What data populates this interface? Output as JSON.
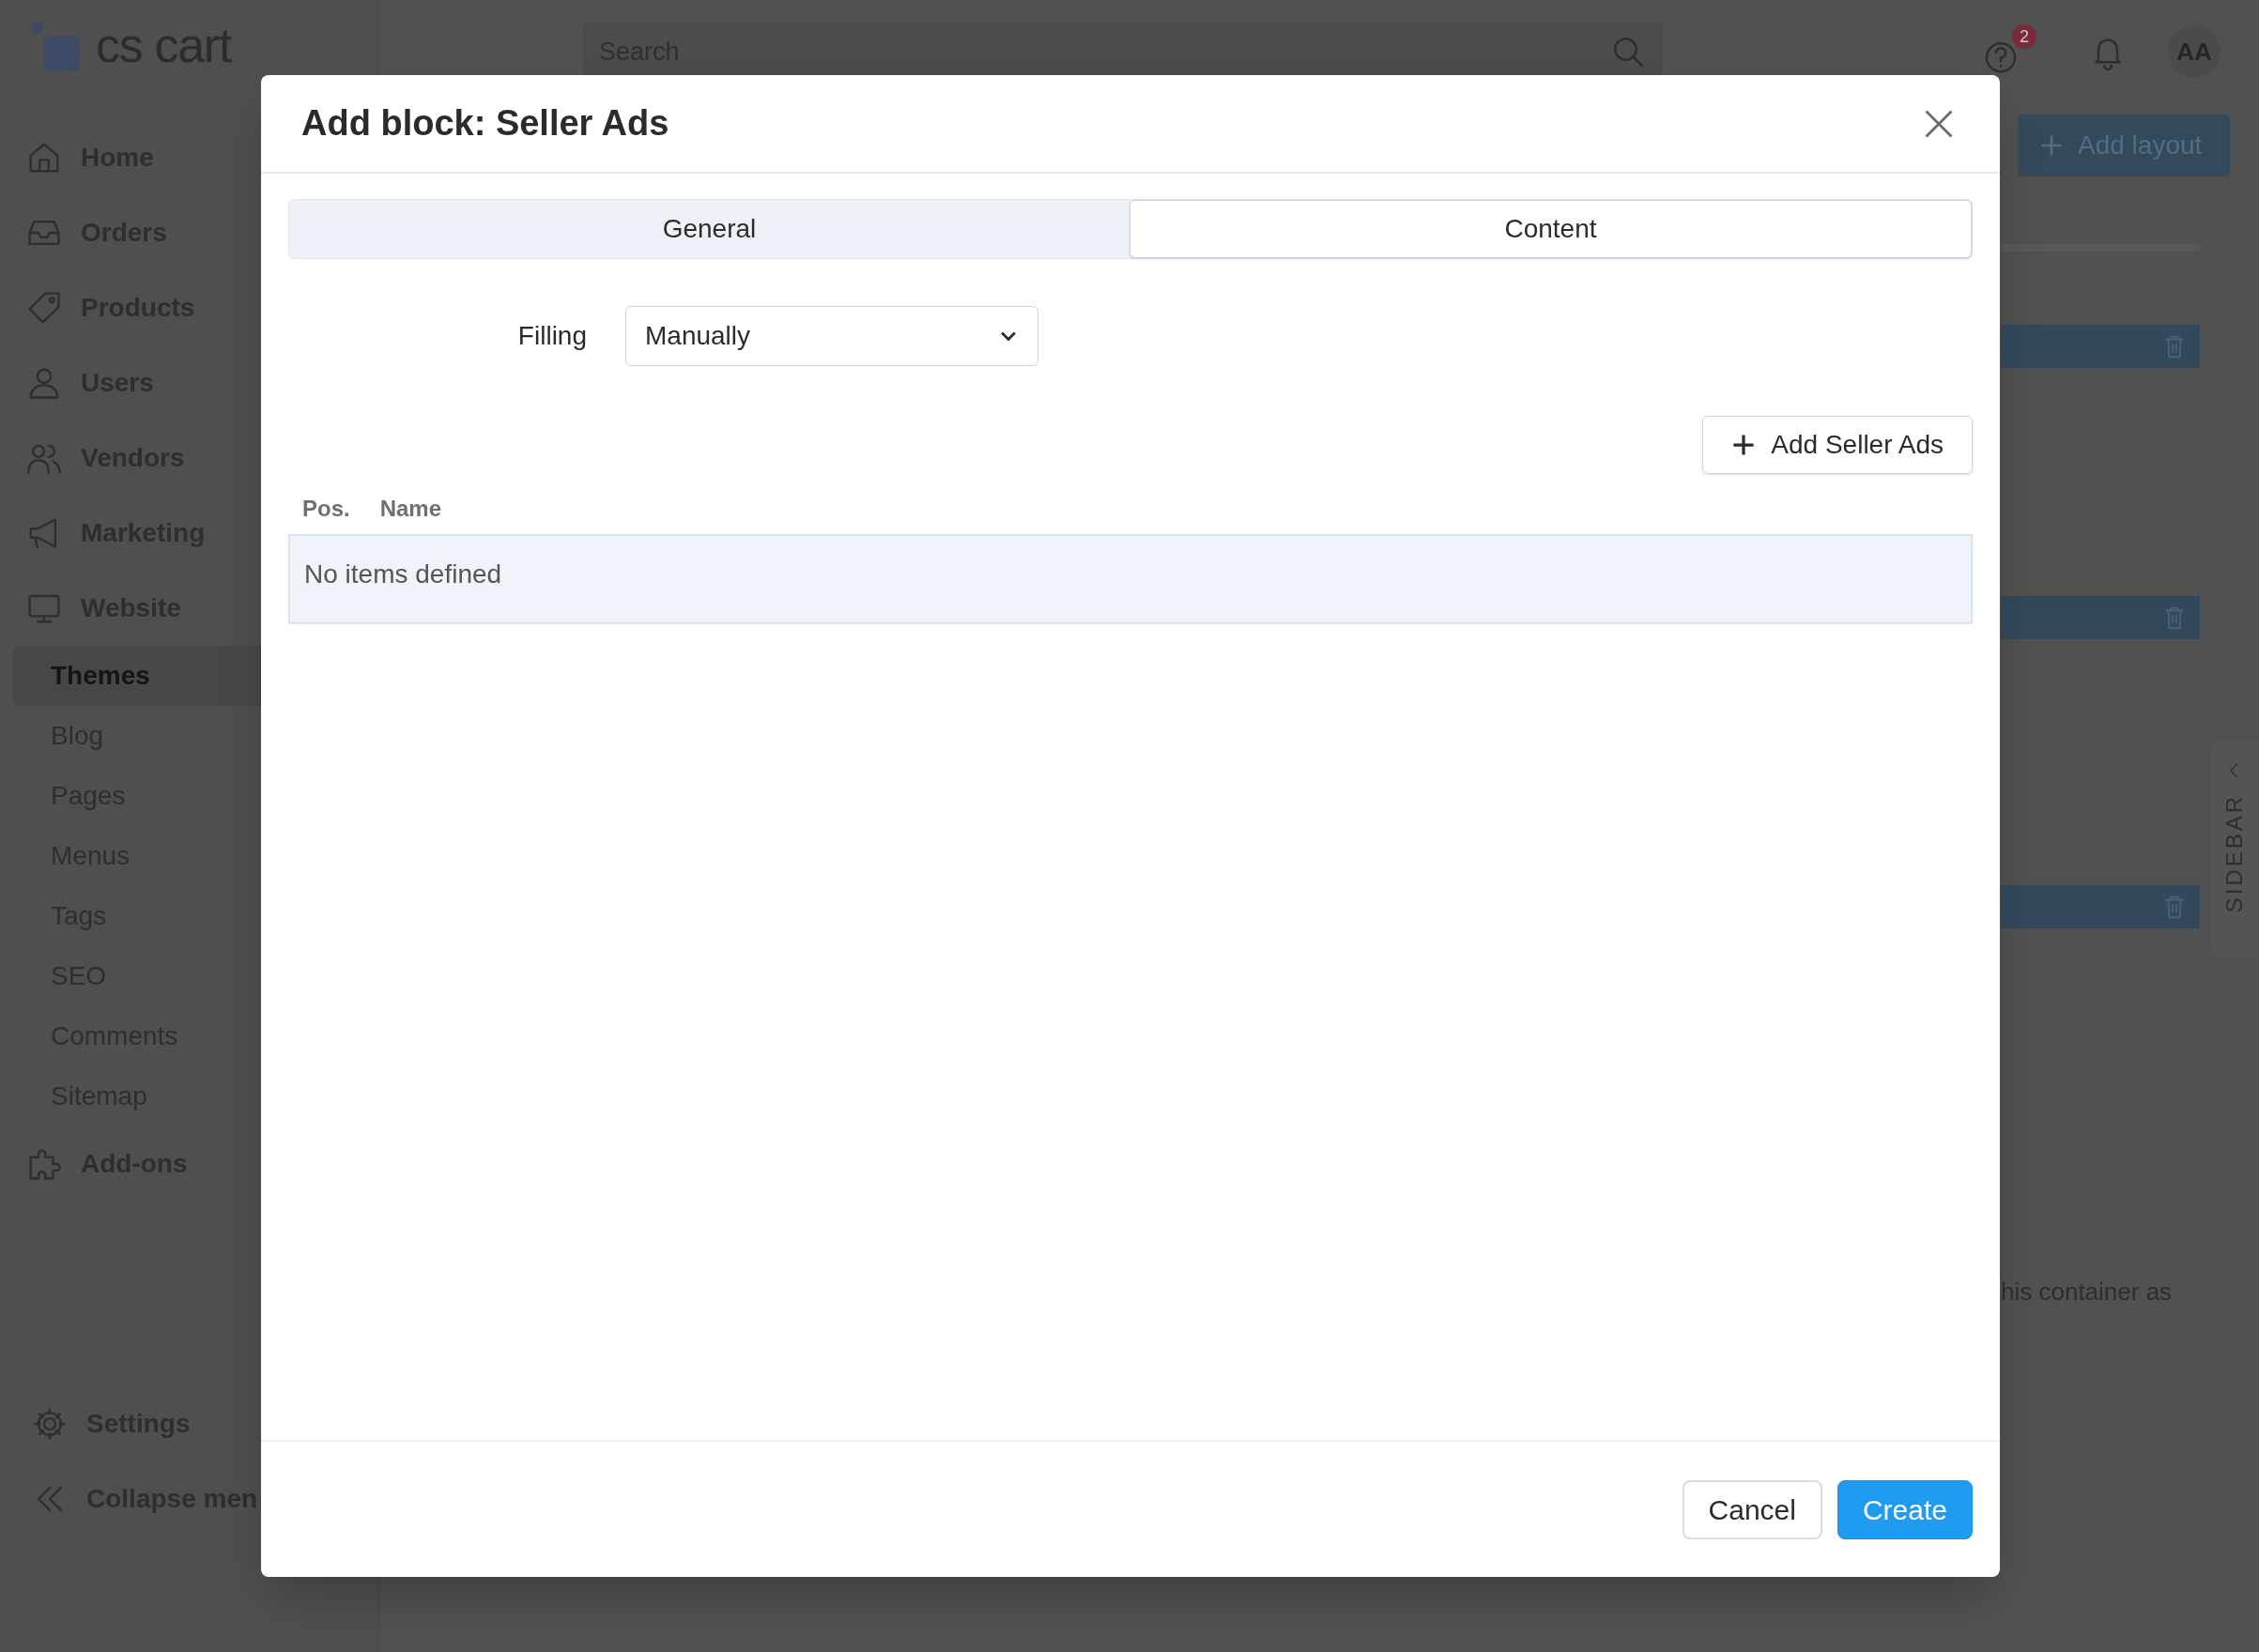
{
  "header": {
    "logo": "cs cart",
    "search": {
      "placeholder": "Search"
    },
    "help_badge": "2",
    "avatar": "AA"
  },
  "sidebar": {
    "items": [
      {
        "label": "Home",
        "kind": "main",
        "selected": false
      },
      {
        "label": "Orders",
        "kind": "main",
        "selected": false
      },
      {
        "label": "Products",
        "kind": "main",
        "selected": false
      },
      {
        "label": "Users",
        "kind": "main",
        "selected": false
      },
      {
        "label": "Vendors",
        "kind": "main",
        "selected": false
      },
      {
        "label": "Marketing",
        "kind": "main",
        "selected": false
      },
      {
        "label": "Website",
        "kind": "main",
        "selected": false
      },
      {
        "label": "Themes",
        "kind": "sub",
        "selected": true
      },
      {
        "label": "Blog",
        "kind": "sub",
        "selected": false
      },
      {
        "label": "Pages",
        "kind": "sub",
        "selected": false
      },
      {
        "label": "Menus",
        "kind": "sub",
        "selected": false
      },
      {
        "label": "Tags",
        "kind": "sub",
        "selected": false
      },
      {
        "label": "SEO",
        "kind": "sub",
        "selected": false
      },
      {
        "label": "Comments",
        "kind": "sub",
        "selected": false
      },
      {
        "label": "Sitemap",
        "kind": "sub",
        "selected": false
      },
      {
        "label": "Add-ons",
        "kind": "main",
        "selected": false
      }
    ],
    "bottom_items": [
      "Settings",
      "Collapse men"
    ]
  },
  "page": {
    "add_layout_button": "Add layout",
    "sidebar_tab": "SIDEBAR",
    "partial_text": "his container as"
  },
  "modal": {
    "title": "Add block: Seller Ads",
    "tabs": [
      {
        "label": "General",
        "selected": false
      },
      {
        "label": "Content",
        "selected": true
      }
    ],
    "filling": {
      "label": "Filling",
      "value": "Manually"
    },
    "add_button": "Add Seller Ads",
    "table": {
      "columns": [
        "Pos.",
        "Name"
      ],
      "empty_text": "No items defined"
    },
    "buttons": [
      {
        "label": "Cancel",
        "kind": "secondary"
      },
      {
        "label": "Create",
        "kind": "primary"
      }
    ]
  }
}
